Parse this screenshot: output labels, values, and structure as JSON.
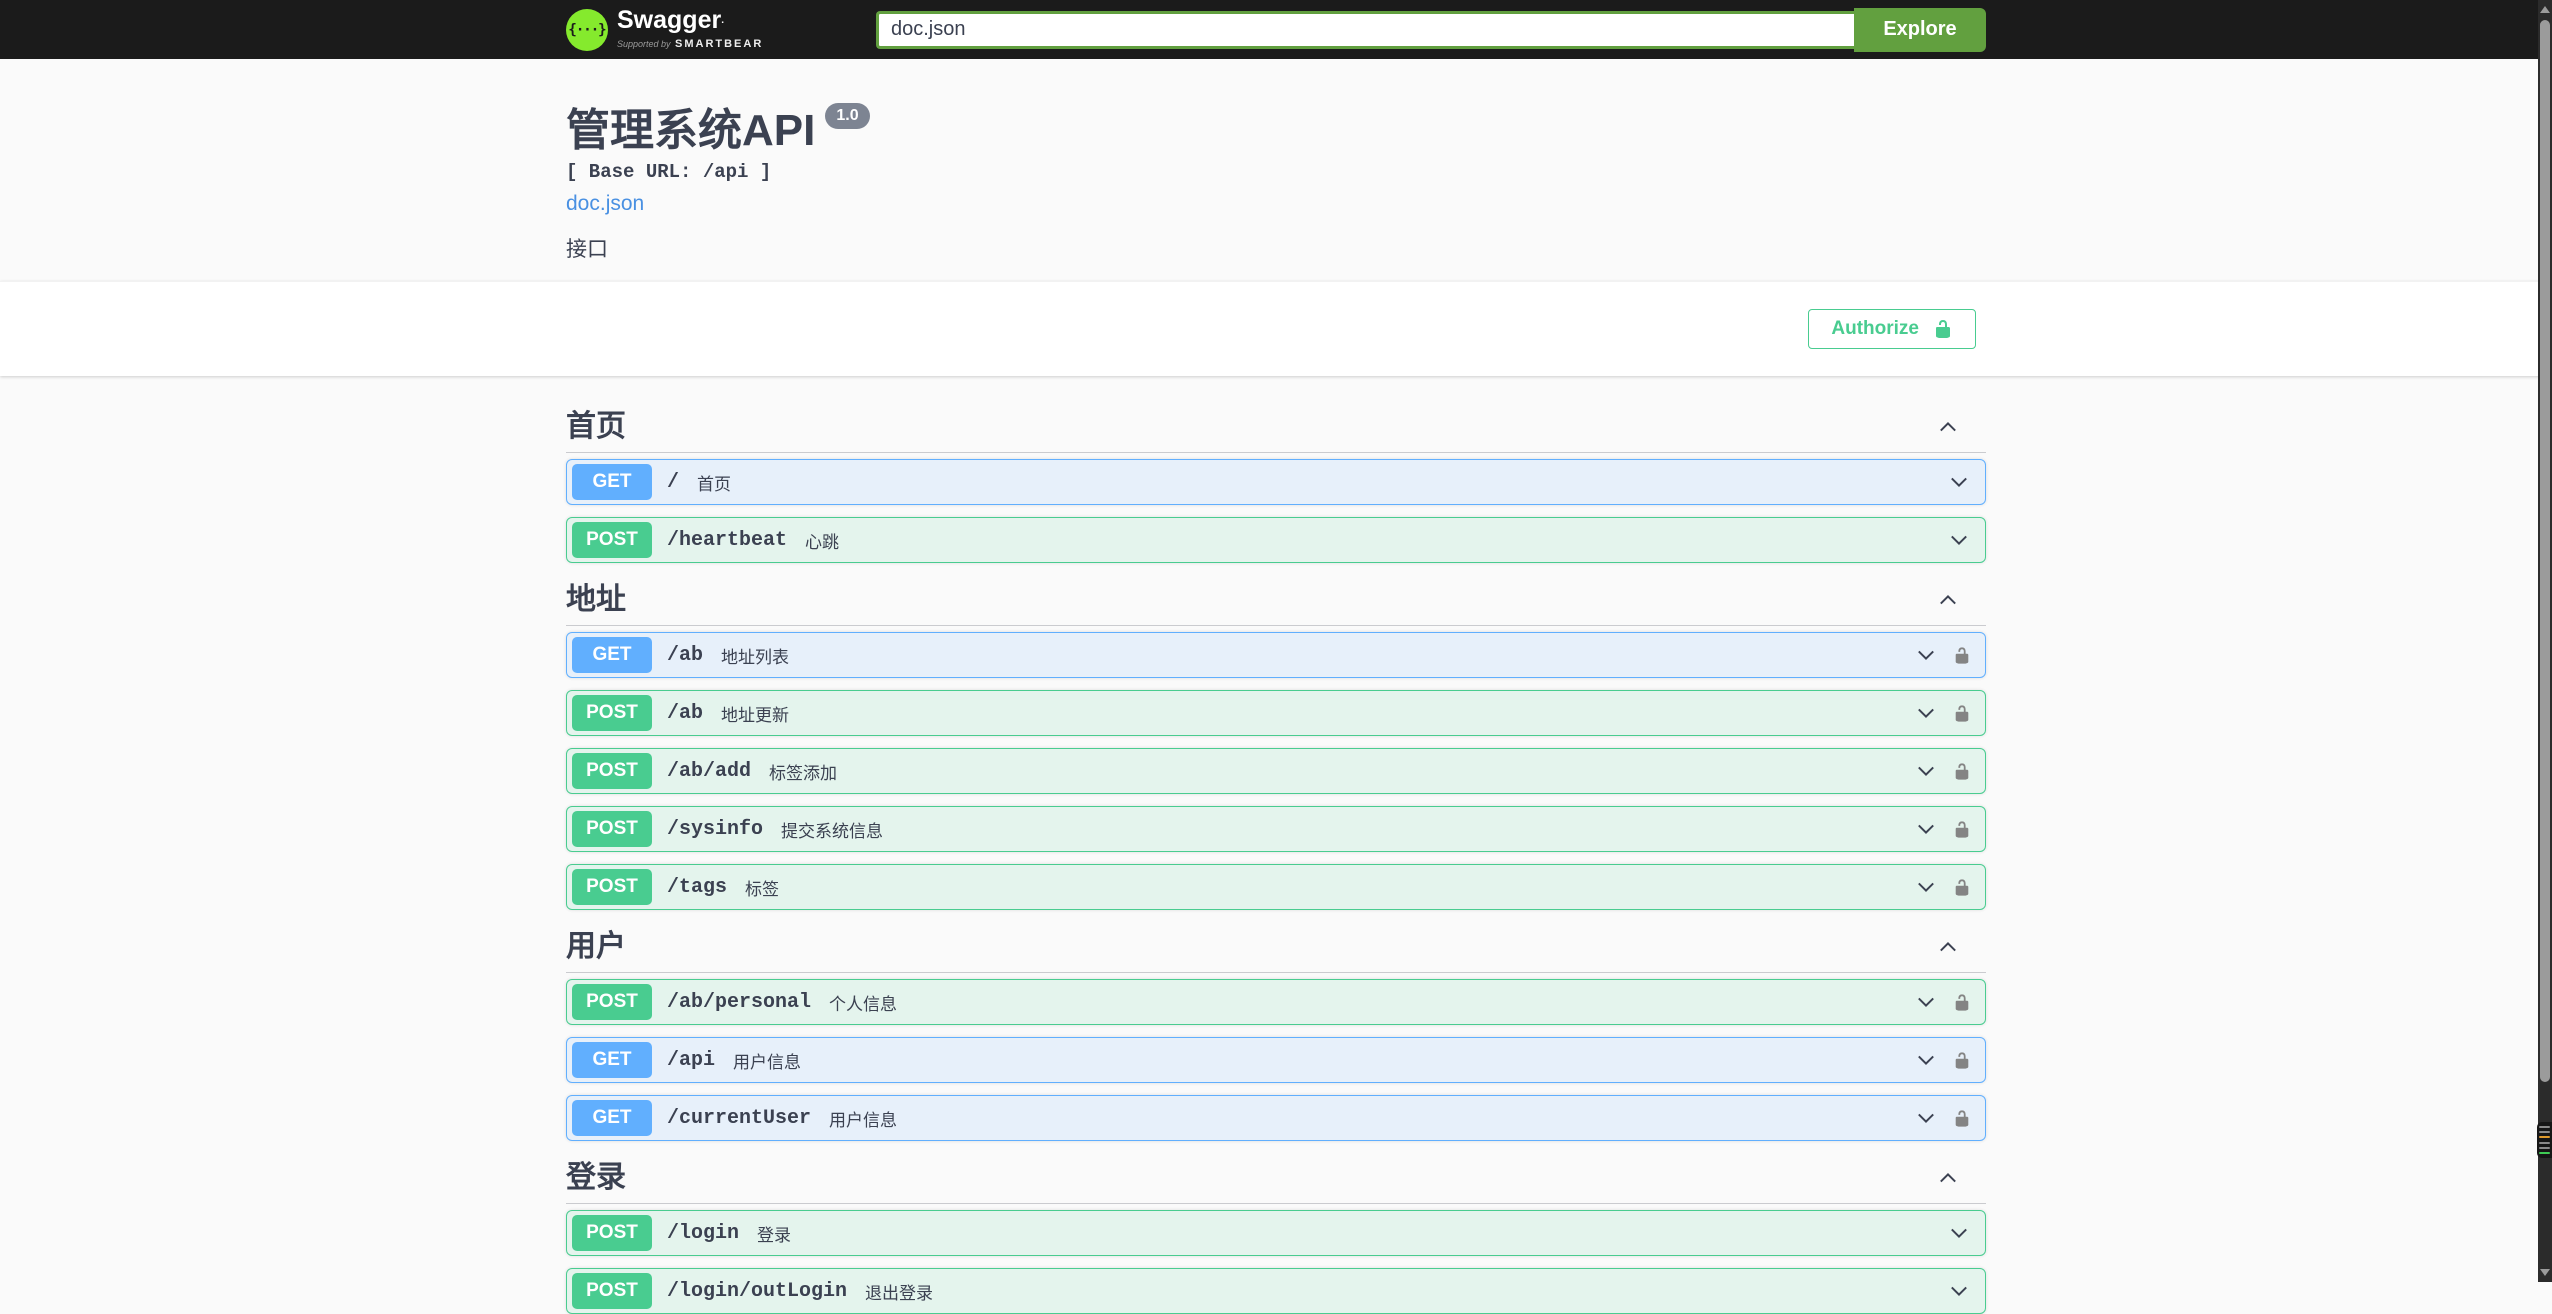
{
  "topbar": {
    "logo_glyph": "{···}",
    "logo_text": "Swagger",
    "logo_trademark": ".",
    "logo_sub_prefix": "Supported by",
    "logo_sub_brand": "SMARTBEAR",
    "search_value": "doc.json",
    "explore_label": "Explore"
  },
  "info": {
    "title": "管理系统API",
    "version": "1.0",
    "base_url_label": "[ Base URL: /api ]",
    "spec_link": "doc.json",
    "description": "接口"
  },
  "auth": {
    "authorize_label": "Authorize"
  },
  "sections": [
    {
      "title": "首页",
      "rows": [
        {
          "method": "GET",
          "path": "/",
          "desc": "首页",
          "lock": false
        },
        {
          "method": "POST",
          "path": "/heartbeat",
          "desc": "心跳",
          "lock": false
        }
      ]
    },
    {
      "title": "地址",
      "rows": [
        {
          "method": "GET",
          "path": "/ab",
          "desc": "地址列表",
          "lock": true
        },
        {
          "method": "POST",
          "path": "/ab",
          "desc": "地址更新",
          "lock": true
        },
        {
          "method": "POST",
          "path": "/ab/add",
          "desc": "标签添加",
          "lock": true
        },
        {
          "method": "POST",
          "path": "/sysinfo",
          "desc": "提交系统信息",
          "lock": true
        },
        {
          "method": "POST",
          "path": "/tags",
          "desc": "标签",
          "lock": true
        }
      ]
    },
    {
      "title": "用户",
      "rows": [
        {
          "method": "POST",
          "path": "/ab/personal",
          "desc": "个人信息",
          "lock": true
        },
        {
          "method": "GET",
          "path": "/api",
          "desc": "用户信息",
          "lock": true
        },
        {
          "method": "GET",
          "path": "/currentUser",
          "desc": "用户信息",
          "lock": true
        }
      ]
    },
    {
      "title": "登录",
      "rows": [
        {
          "method": "POST",
          "path": "/login",
          "desc": "登录",
          "lock": false
        },
        {
          "method": "POST",
          "path": "/login/outLogin",
          "desc": "退出登录",
          "lock": false
        }
      ]
    }
  ],
  "colors": {
    "topbar_bg": "#1b1b1b",
    "logo_green": "#85ea2d",
    "explore_green": "#62a03f",
    "get_blue": "#61affe",
    "post_green": "#49cc90",
    "authorize_green": "#49cc90",
    "link_blue": "#4990e2",
    "text": "#3b4151",
    "version_badge_bg": "#7d8492",
    "page_bg": "#fafafa"
  }
}
